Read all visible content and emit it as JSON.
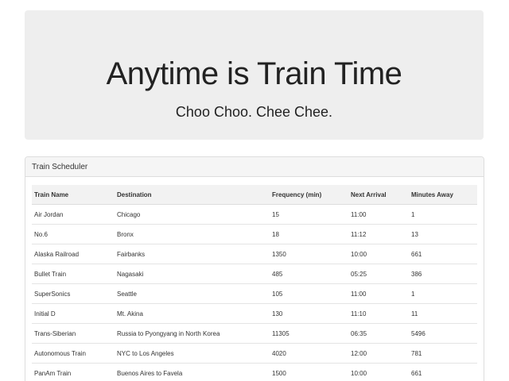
{
  "jumbotron": {
    "title": "Anytime is Train Time",
    "subtitle": "Choo Choo. Chee Chee."
  },
  "panel": {
    "heading": "Train Scheduler"
  },
  "table": {
    "headers": [
      "Train Name",
      "Destination",
      "Frequency (min)",
      "Next Arrival",
      "Minutes Away"
    ],
    "rows": [
      [
        "Air Jordan",
        "Chicago",
        "15",
        "11:00",
        "1"
      ],
      [
        "No.6",
        "Bronx",
        "18",
        "11:12",
        "13"
      ],
      [
        "Alaska Railroad",
        "Fairbanks",
        "1350",
        "10:00",
        "661"
      ],
      [
        "Bullet Train",
        "Nagasaki",
        "485",
        "05:25",
        "386"
      ],
      [
        "SuperSonics",
        "Seattle",
        "105",
        "11:00",
        "1"
      ],
      [
        "Initial D",
        "Mt. Akina",
        "130",
        "11:10",
        "11"
      ],
      [
        "Trans-Siberian",
        "Russia to Pyongyang in North Korea",
        "11305",
        "06:35",
        "5496"
      ],
      [
        "Autonomous Train",
        "NYC to Los Angeles",
        "4020",
        "12:00",
        "781"
      ],
      [
        "PanAm Train",
        "Buenos Aires to Favela",
        "1500",
        "10:00",
        "661"
      ]
    ]
  }
}
